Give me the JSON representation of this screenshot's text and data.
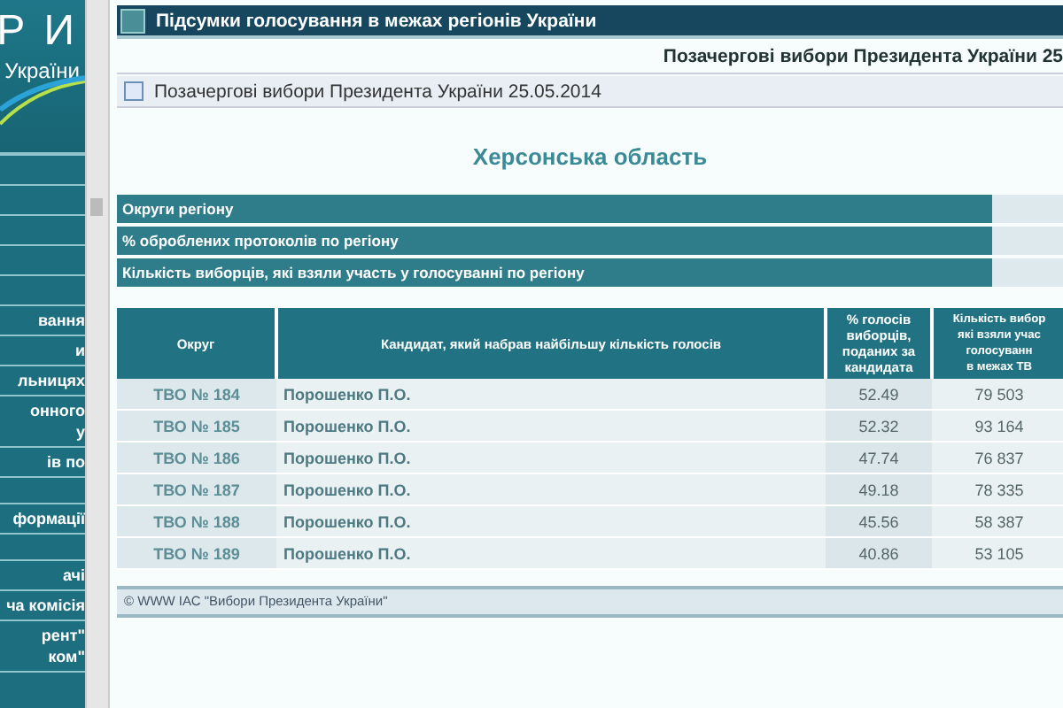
{
  "sidebar": {
    "logo": {
      "letters": "Р И",
      "subtitle": "України"
    },
    "items": [
      {
        "lines": [
          "вання"
        ]
      },
      {
        "lines": [
          "и"
        ]
      },
      {
        "lines": [
          "льницях"
        ]
      },
      {
        "lines": [
          "онного",
          "у"
        ]
      },
      {
        "lines": [
          "ів по"
        ]
      },
      {
        "lines": [
          "формації"
        ]
      },
      {
        "lines": [
          "ачі"
        ]
      },
      {
        "lines": [
          "ча комісія"
        ]
      },
      {
        "lines": [
          "рент\"",
          "ком\""
        ]
      }
    ]
  },
  "title_bar": {
    "title": "Підсумки голосування в межах регіонів України"
  },
  "election_heading": "Позачергові вибори Президента України 25",
  "election_selector": {
    "label": "Позачергові вибори Президента України 25.05.2014"
  },
  "region_title": "Херсонська область",
  "summary": [
    {
      "label": "Округи регіону"
    },
    {
      "label": "% оброблених протоколів по регіону"
    },
    {
      "label": "Кількість виборців, які взяли участь у голосуванні по регіону"
    }
  ],
  "table": {
    "columns": [
      {
        "lines": [
          "Округ"
        ]
      },
      {
        "lines": [
          "Кандидат, який набрав найбільшу кількість голосів"
        ]
      },
      {
        "lines": [
          "% голосів",
          "виборців,",
          "поданих за",
          "кандидата"
        ]
      },
      {
        "lines": [
          "Кількість вибор",
          "які взяли учас",
          "голосуванн",
          "в межах ТВ"
        ]
      }
    ],
    "rows": [
      [
        "ТВО № 184",
        "Порошенко П.О.",
        "52.49",
        "79 503"
      ],
      [
        "ТВО № 185",
        "Порошенко П.О.",
        "52.32",
        "93 164"
      ],
      [
        "ТВО № 186",
        "Порошенко П.О.",
        "47.74",
        "76 837"
      ],
      [
        "ТВО № 187",
        "Порошенко П.О.",
        "49.18",
        "78 335"
      ],
      [
        "ТВО № 188",
        "Порошенко П.О.",
        "45.56",
        "58 387"
      ],
      [
        "ТВО № 189",
        "Порошенко П.О.",
        "40.86",
        "53 105"
      ]
    ]
  },
  "footer": "© WWW ІАС \"Вибори Президента України\""
}
